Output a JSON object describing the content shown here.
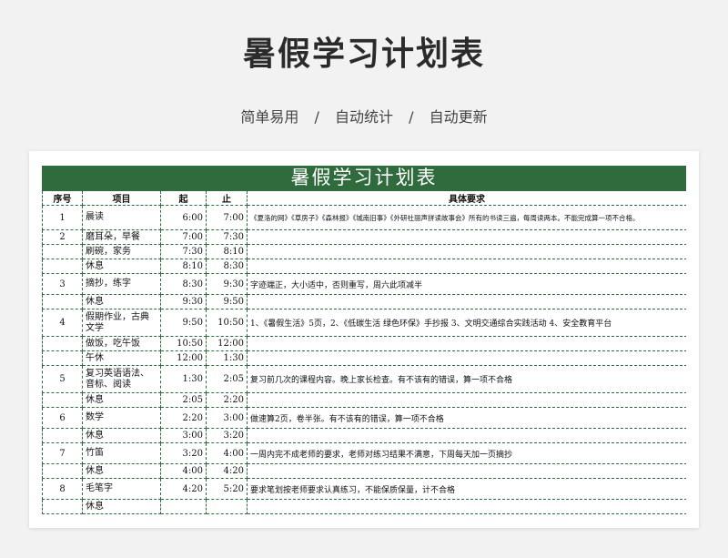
{
  "header": {
    "title": "暑假学习计划表",
    "tags": [
      "简单易用",
      "自动统计",
      "自动更新"
    ],
    "separator": "/"
  },
  "sheet": {
    "title": "暑假学习计划表",
    "columns": [
      "序号",
      "项目",
      "起",
      "止",
      "具体要求"
    ],
    "rows": [
      {
        "no": "1",
        "item": "晨读",
        "start": "6:00",
        "end": "7:00",
        "req": "《夏洛的网》《草房子》《森林报》《城南旧事》《外研社丽声拼读故事会》所有的书读三遍，每周读两本。不能完成算一项不合格。"
      },
      {
        "no": "2",
        "item": "磨耳朵，早餐",
        "start": "7:00",
        "end": "7:30",
        "req": ""
      },
      {
        "no": "",
        "item": "刷碗，家务",
        "start": "7:30",
        "end": "8:10",
        "req": ""
      },
      {
        "no": "",
        "item": "休息",
        "start": "8:10",
        "end": "8:30",
        "req": ""
      },
      {
        "no": "3",
        "item": "摘抄，练字",
        "start": "8:30",
        "end": "9:30",
        "req": "字迹端正，大小适中，否则重写，周六此项减半"
      },
      {
        "no": "",
        "item": "休息",
        "start": "9:30",
        "end": "9:50",
        "req": ""
      },
      {
        "no": "4",
        "item": "假期作业，古典文学",
        "start": "9:50",
        "end": "10:50",
        "req": "1、《暑假生活》5页，2、《低碳生活 绿色环保》手抄报  3、文明交通综合实践活动 4、安全教育平台"
      },
      {
        "no": "",
        "item": "做饭，吃午饭",
        "start": "10:50",
        "end": "12:00",
        "req": ""
      },
      {
        "no": "",
        "item": "午休",
        "start": "12:00",
        "end": "1:30",
        "req": ""
      },
      {
        "no": "5",
        "item": "复习英语语法、音标、阅读",
        "start": "1:30",
        "end": "2:05",
        "req": "复习前几次的课程内容。晚上家长检查。有不该有的错误，算一项不合格"
      },
      {
        "no": "",
        "item": "休息",
        "start": "2:05",
        "end": "2:20",
        "req": ""
      },
      {
        "no": "6",
        "item": "数学",
        "start": "2:20",
        "end": "3:00",
        "req": "做速算2页，卷半张。有不该有的错误，算一项不合格"
      },
      {
        "no": "",
        "item": "休息",
        "start": "3:00",
        "end": "3:20",
        "req": ""
      },
      {
        "no": "7",
        "item": "竹笛",
        "start": "3:20",
        "end": "4:00",
        "req": "一周内完不成老师的要求，老师对练习结果不满意，下周每天加一页摘抄"
      },
      {
        "no": "",
        "item": "休息",
        "start": "4:00",
        "end": "4:20",
        "req": ""
      },
      {
        "no": "8",
        "item": "毛笔字",
        "start": "4:20",
        "end": "5:20",
        "req": "要求笔划按老师要求认真练习，不能保质保量，计不合格"
      },
      {
        "no": "",
        "item": "休息",
        "start": "",
        "end": "",
        "req": ""
      }
    ]
  }
}
